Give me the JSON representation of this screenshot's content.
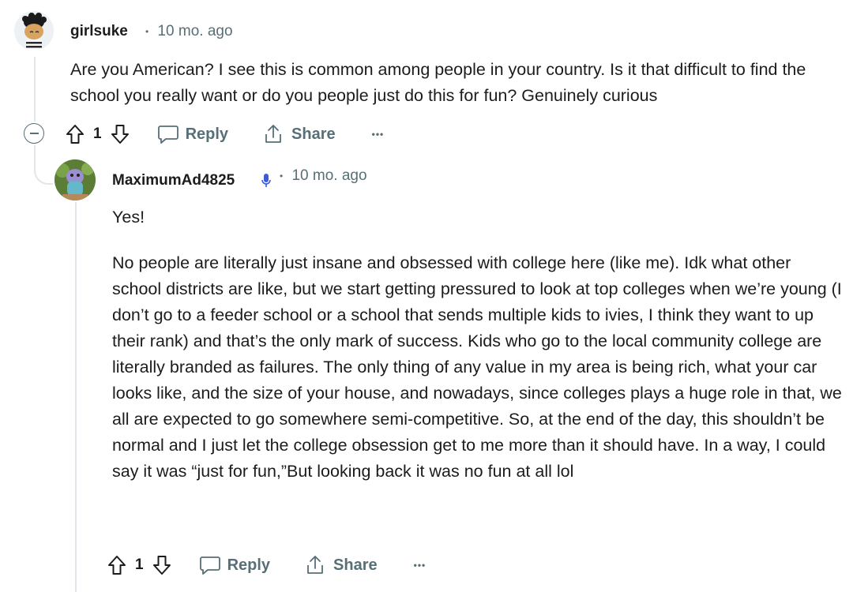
{
  "comments": [
    {
      "username": "girlsuke",
      "separator": "•",
      "time": "10 mo. ago",
      "paragraphs": [
        "Are you American? I see this is common among people in your country. Is it that difficult to find the school you really want or do you people just do this for fun? Genuinely curious"
      ],
      "votes": "1",
      "reply_label": "Reply",
      "share_label": "Share",
      "more_label": "•••",
      "avatar_icon": "snoo-avatar-icon"
    },
    {
      "username": "MaximumAd4825",
      "separator": "•",
      "time": "10 mo. ago",
      "badge_icon": "microphone-icon",
      "paragraphs": [
        "Yes!",
        "No people are literally just insane and obsessed with college here (like me). Idk what other school districts are like, but we start getting pressured to look at top colleges when we’re young (I don’t go to a feeder school or a school that sends multiple kids to ivies, I think they want to up their rank) and that’s the only mark of success. Kids who go to the local community college are literally branded as failures. The only thing of any value in my area is being rich, what your car looks like, and the size of your house, and nowadays, since colleges plays a huge role in that, we all are expected to go somewhere semi-competitive. So, at the end of the day, this shouldn’t be normal and I just let the college obsession get to me more than it should have. In a way, I could say it was “just for fun,”But looking back it was no fun at all lol"
      ],
      "votes": "1",
      "reply_label": "Reply",
      "share_label": "Share",
      "more_label": "•••",
      "avatar_icon": "snoo-avatar-icon"
    }
  ],
  "colors": {
    "meta": "#576f76",
    "text": "#1c1c1c",
    "thread": "#e2e6ea",
    "badge": "#3d5adb"
  }
}
